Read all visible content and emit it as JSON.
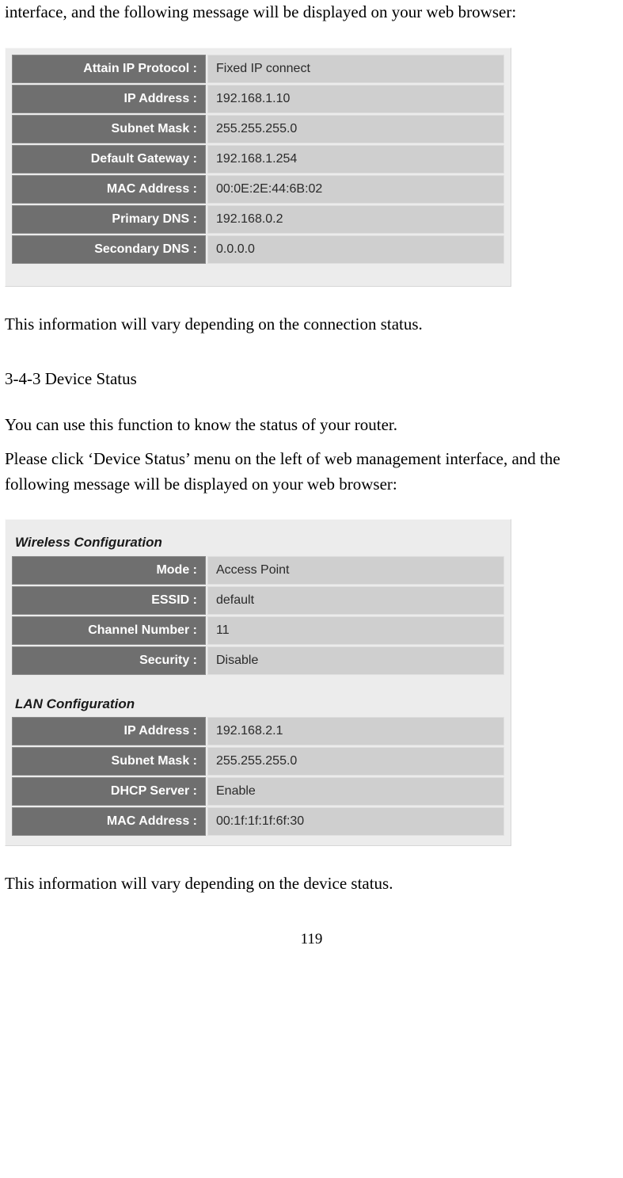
{
  "intro_para1": "interface, and the following message will be displayed on your web browser:",
  "note1": "This information will vary depending on the connection status.",
  "section_title": "3-4-3 Device Status",
  "para2": "You can use this function to know the status of your router.",
  "para3": "Please click ‘Device Status’ menu on the left of web management interface, and the following message will be displayed on your web browser:",
  "note2": "This information will vary depending on the device status.",
  "page_number": "119",
  "ip_table": {
    "rows": [
      {
        "label": "Attain IP Protocol :",
        "value": "Fixed IP connect"
      },
      {
        "label": "IP Address :",
        "value": "192.168.1.10"
      },
      {
        "label": "Subnet Mask :",
        "value": "255.255.255.0"
      },
      {
        "label": "Default Gateway :",
        "value": "192.168.1.254"
      },
      {
        "label": "MAC Address :",
        "value": "00:0E:2E:44:6B:02"
      },
      {
        "label": "Primary DNS :",
        "value": "192.168.0.2"
      },
      {
        "label": "Secondary DNS :",
        "value": "0.0.0.0"
      }
    ]
  },
  "device_panel": {
    "wireless_heading": "Wireless Configuration",
    "wireless_rows": [
      {
        "label": "Mode :",
        "value": "Access Point"
      },
      {
        "label": "ESSID :",
        "value": "default"
      },
      {
        "label": "Channel Number :",
        "value": "11"
      },
      {
        "label": "Security :",
        "value": "Disable"
      }
    ],
    "lan_heading": "LAN Configuration",
    "lan_rows": [
      {
        "label": "IP Address :",
        "value": "192.168.2.1"
      },
      {
        "label": "Subnet Mask :",
        "value": "255.255.255.0"
      },
      {
        "label": "DHCP Server :",
        "value": "Enable"
      },
      {
        "label": "MAC Address :",
        "value": "00:1f:1f:1f:6f:30"
      }
    ]
  }
}
